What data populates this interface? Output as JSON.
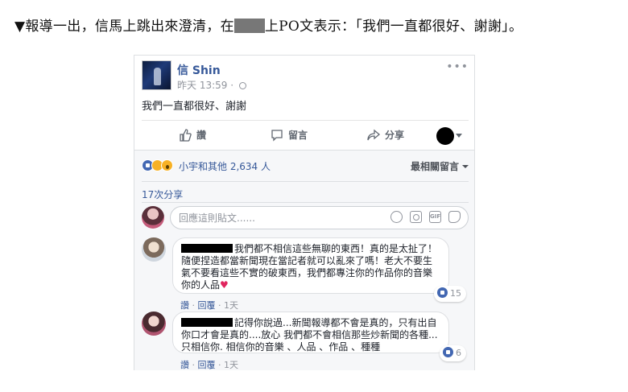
{
  "headline": {
    "text_before": "▼報導一出，信馬上跳出來澄清，在",
    "text_after": "上PO文表示：「我們一直都很好、謝謝」。"
  },
  "post": {
    "author": "信 Shin",
    "timestamp": "昨天 13:59",
    "meta_separator": "·",
    "more": "•••",
    "content": "我們一直都很好、謝謝"
  },
  "actions": {
    "like_label": "讚",
    "comment_label": "留言",
    "share_label": "分享"
  },
  "reactions": {
    "icons": [
      "like-icon",
      "haha-icon",
      "wow-icon"
    ],
    "summary": "小宇和其他 2,634 人",
    "sort_label": "最相關留言"
  },
  "shares": {
    "label": "17次分享"
  },
  "comment_box": {
    "placeholder": "回應這則貼文......"
  },
  "comments": [
    {
      "text": "我們都不相信這些無聊的東西！真的是太扯了！隨便捏造都當新聞現在當記者就可以亂來了嗎！老大不要生氣不要看這些不實的破東西，我們都專注你的作品你的音樂你的人品",
      "heart": "♥",
      "like_count": "15",
      "like_label": "讚",
      "reply_label": "回覆",
      "time": "1天",
      "sep": "·"
    },
    {
      "text": "記得你說過...新聞報導都不會是真的，只有出自你口才會是真的....放心 我們都不會相信那些炒新聞的各種...只相信你. 相信你的音樂 、人品 、作品 、種種",
      "like_count": "6",
      "like_label": "讚",
      "reply_label": "回覆",
      "time": "1天",
      "sep": "·"
    }
  ],
  "colors": {
    "link_blue": "#365899",
    "fb_blue": "#4267b2",
    "heart_red": "#e0245e",
    "muted": "#90949c",
    "comment_bg": "#f6f7f9"
  }
}
